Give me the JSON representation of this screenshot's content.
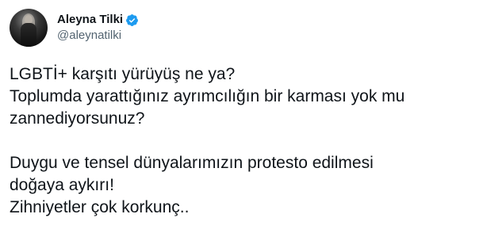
{
  "tweet": {
    "author": {
      "display_name": "Aleyna Tilki",
      "handle": "@aleynatilki",
      "verified_icon": "verified-badge-icon",
      "verified_color": "#1d9bf0"
    },
    "paragraphs": [
      [
        "LGBTİ+ karşıtı yürüyüş ne ya?",
        "Toplumda yarattığınız ayrımcılığın bir karması yok mu",
        "zannediyorsunuz?"
      ],
      [
        "Duygu ve tensel dünyalarımızın protesto edilmesi",
        "doğaya aykırı!",
        "Zihniyetler çok korkunç.."
      ]
    ]
  }
}
